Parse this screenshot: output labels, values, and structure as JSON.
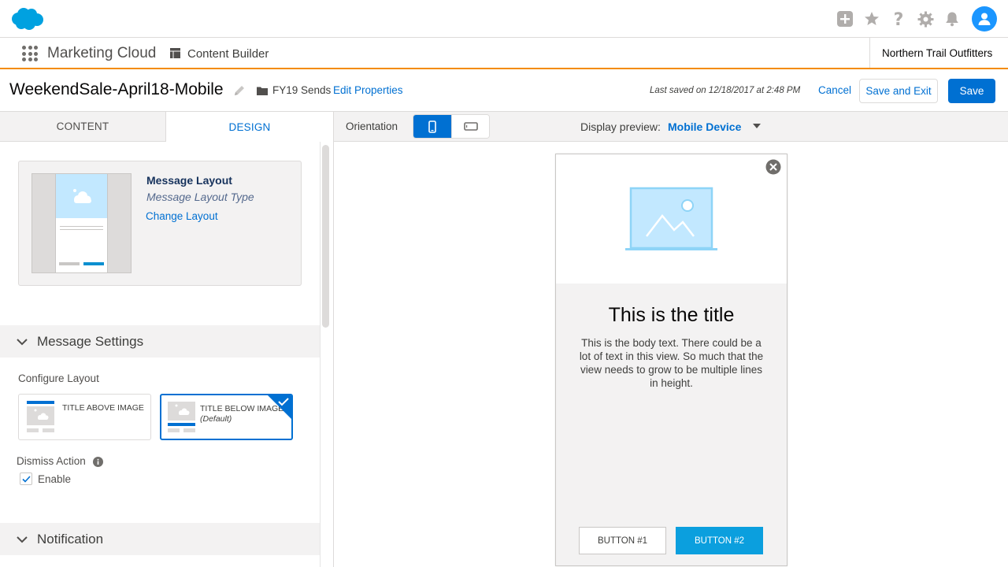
{
  "global_header": {
    "icons": [
      "plus-icon",
      "star-icon",
      "help-icon",
      "gear-icon",
      "bell-icon",
      "avatar-icon"
    ]
  },
  "app_nav": {
    "app_name": "Marketing Cloud",
    "section": "Content Builder",
    "business_unit": "Northern Trail Outfitters"
  },
  "title_bar": {
    "title": "WeekendSale-April18-Mobile",
    "folder": "FY19 Sends",
    "edit_properties": "Edit Properties",
    "last_saved": "Last saved on 12/18/2017 at 2:48 PM",
    "cancel": "Cancel",
    "save_exit": "Save and Exit",
    "save": "Save"
  },
  "left_panel": {
    "tabs": [
      {
        "label": "CONTENT",
        "active": false
      },
      {
        "label": "DESIGN",
        "active": true
      }
    ],
    "layout_card": {
      "title": "Message Layout",
      "type": "Message Layout Type",
      "change": "Change Layout"
    },
    "message_settings": {
      "header": "Message Settings",
      "configure_label": "Configure Layout",
      "options": [
        {
          "label": "TITLE ABOVE IMAGE",
          "selected": false
        },
        {
          "label": "TITLE BELOW IMAGE",
          "suffix": "(Default)",
          "selected": true
        }
      ],
      "dismiss_label": "Dismiss Action",
      "enable_label": "Enable",
      "enable_checked": true
    },
    "notification": {
      "header": "Notification"
    }
  },
  "preview": {
    "orientation_label": "Orientation",
    "orientation_selected": "portrait",
    "display_preview_label": "Display preview:",
    "display_preview_value": "Mobile Device",
    "phone": {
      "title": "This is the title",
      "body": "This is the body text. There could be a lot of text in this view. So much that the view  needs to grow to be multiple lines in height.",
      "button1": "BUTTON #1",
      "button2": "BUTTON #2"
    }
  },
  "colors": {
    "brand": "#0070d2",
    "accent_orange": "#f38b00",
    "preview_button": "#0b9fde"
  }
}
